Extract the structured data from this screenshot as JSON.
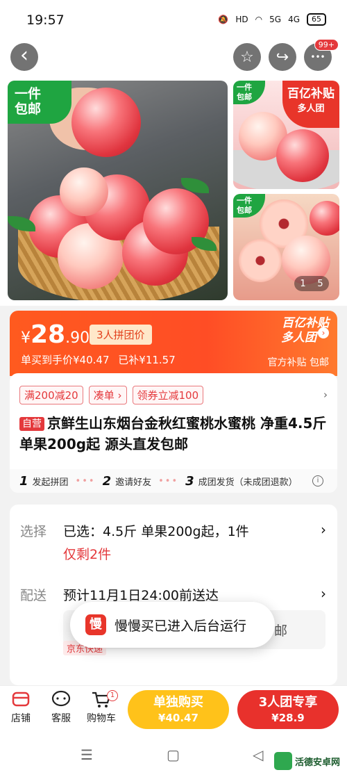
{
  "status": {
    "time": "19:57",
    "hd": "HD",
    "sig1": "5G",
    "sig2": "4G",
    "battery": "65"
  },
  "nav": {
    "back": "‹",
    "star": "☆",
    "share": "↪",
    "more": "•••",
    "more_badge": "99+"
  },
  "gallery": {
    "main_tag_line1": "一件",
    "main_tag_line2": "包邮",
    "side_tag_line1": "一件",
    "side_tag_line2": "包邮",
    "side2_tag_line1": "一件",
    "side2_tag_line2": "包邮",
    "corner_line1": "百亿补贴",
    "corner_line2": "多人团",
    "page_current": "1",
    "page_total": "5"
  },
  "price": {
    "symbol": "¥",
    "integer": "28",
    "decimal": ".90",
    "group_tag": "3人拼团价",
    "single_price": "单买到手价¥40.47",
    "subsidy": "已补¥11.57",
    "bt_line1": "百亿补贴",
    "bt_line2": "多人团",
    "bt_sub": "官方补贴 包邮",
    "bt_arrow": "›"
  },
  "info": {
    "coupon1": "满200减20",
    "coupon2": "凑单 ›",
    "coupon3": "领券立减100",
    "coupon_arrow": "›",
    "self_tag": "自营",
    "title": "京鲜生山东烟台金秋红蜜桃水蜜桃 净重4.5斤 单果200g起 源头直发包邮",
    "step1_num": "1",
    "step1": "发起拼团",
    "step2_num": "2",
    "step2": "邀请好友",
    "step3_num": "3",
    "step3": "成团发货（未成团退款）",
    "dots": "•••",
    "info_icon": "i"
  },
  "select": {
    "choose_label": "选择",
    "choose_value": "已选：4.5斤 单果200g起，1件",
    "stock": "仅剩2件",
    "deliver_label": "配送",
    "deliver_value": "预计11月1日24:00前送达",
    "ship_text": "邮",
    "express": "京东快递",
    "arrow": "›"
  },
  "toast": {
    "logo": "慢",
    "text": "慢慢买已进入后台运行"
  },
  "bottom": {
    "store": "店铺",
    "service": "客服",
    "cart": "购物车",
    "cart_badge": "1",
    "single_title": "单独购买",
    "single_price": "¥40.47",
    "group_title": "3人团专享",
    "group_price": "¥28.9"
  },
  "sysnav": {
    "menu": "☰",
    "home": "▢",
    "back": "◁"
  },
  "watermark": "活德安卓网"
}
